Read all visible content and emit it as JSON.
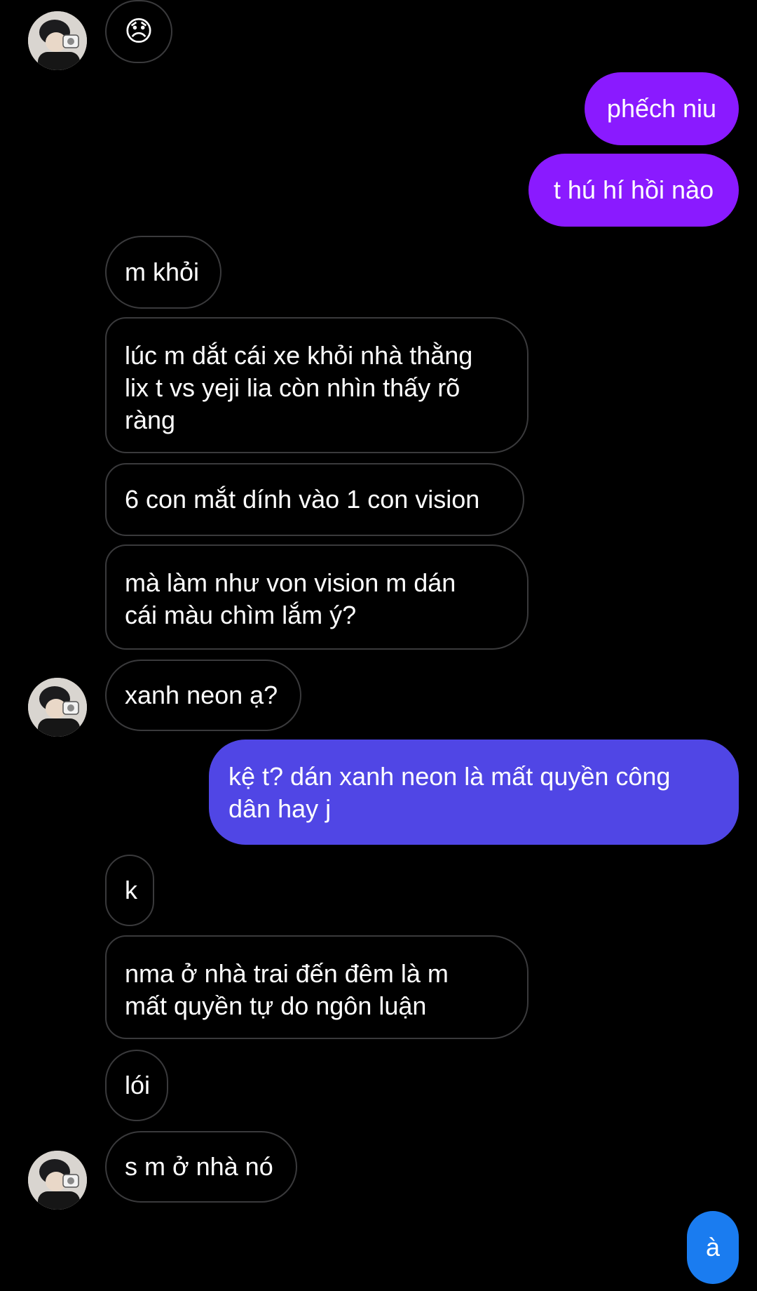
{
  "colors": {
    "background": "#000000",
    "received_border": "#3a3a3c",
    "sent_purple": "#8a1aff",
    "sent_indigo": "#5046e5",
    "sent_blue": "#1a7cf0"
  },
  "messages": [
    {
      "side": "received",
      "text": "😞",
      "avatar": true
    },
    {
      "side": "sent",
      "text": "phếch niu"
    },
    {
      "side": "sent",
      "text": "t hú hí hồi nào"
    },
    {
      "side": "received",
      "text": "m khỏi"
    },
    {
      "side": "received",
      "text": "lúc m dắt cái xe khỏi nhà thằng\nlix t vs yeji lia còn nhìn thấy rõ\nràng"
    },
    {
      "side": "received",
      "text": "6 con mắt dính vào 1 con vision"
    },
    {
      "side": "received",
      "text": "mà làm như von vision m dán\ncái màu chìm lắm ý?"
    },
    {
      "side": "received",
      "text": "xanh neon ạ?",
      "avatar": true
    },
    {
      "side": "sent",
      "text": "kệ t? dán xanh neon là mất quyền công\ndân hay j"
    },
    {
      "side": "received",
      "text": "k"
    },
    {
      "side": "received",
      "text": "nma ở nhà trai đến đêm là m\nmất quyền tự do ngôn luận"
    },
    {
      "side": "received",
      "text": "lói"
    },
    {
      "side": "received",
      "text": "s m ở nhà nó",
      "avatar": true
    },
    {
      "side": "sent",
      "text": "à"
    }
  ]
}
